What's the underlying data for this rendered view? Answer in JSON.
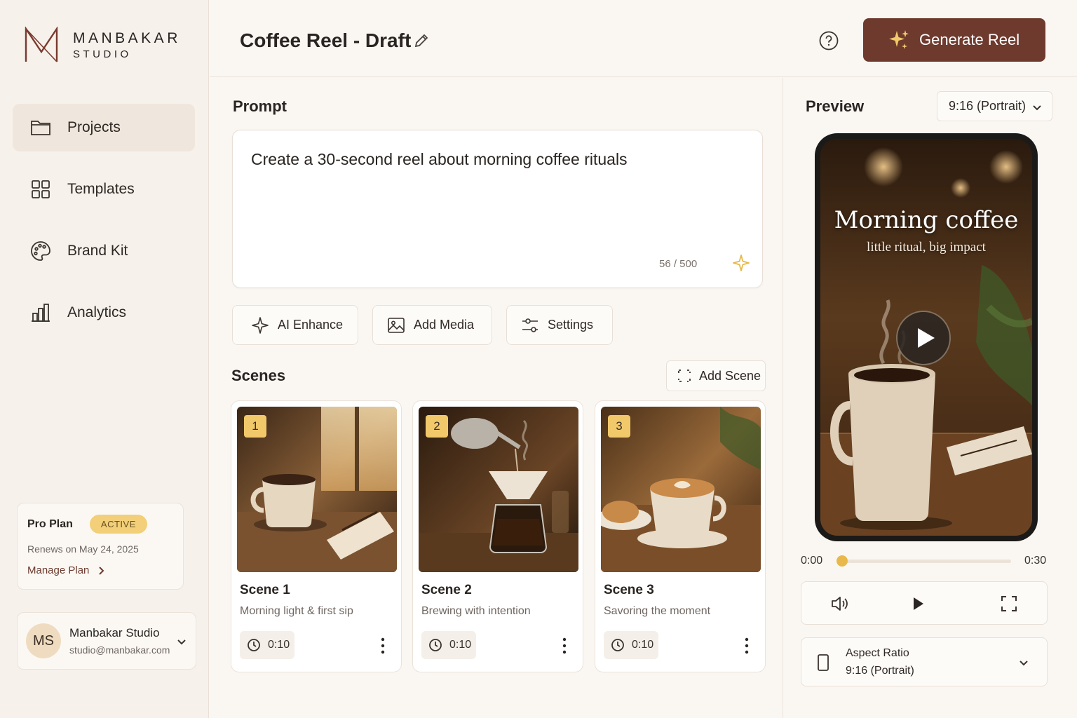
{
  "brand": {
    "name": "MANBAKAR",
    "sub": "STUDIO"
  },
  "sidebar": {
    "items": [
      {
        "label": "Projects",
        "icon": "folder-icon",
        "active": true
      },
      {
        "label": "Templates",
        "icon": "grid-icon"
      },
      {
        "label": "Brand Kit",
        "icon": "palette-icon"
      },
      {
        "label": "Analytics",
        "icon": "bar-chart-icon"
      }
    ]
  },
  "plan": {
    "title": "Pro Plan",
    "badge": "ACTIVE",
    "renews": "Renews on May 24, 2025",
    "manage": "Manage Plan"
  },
  "account": {
    "initials": "MS",
    "name": "Manbakar Studio",
    "email": "studio@manbakar.com"
  },
  "header": {
    "title": "Coffee Reel - Draft",
    "generate_label": "Generate Reel"
  },
  "prompt": {
    "section_title": "Prompt",
    "text": "Create a 30-second reel about morning coffee rituals",
    "char_count": "56 / 500"
  },
  "tools": {
    "ai_enhance": "AI Enhance",
    "add_media": "Add Media",
    "settings": "Settings"
  },
  "scenes": {
    "section_title": "Scenes",
    "add_label": "Add Scene",
    "items": [
      {
        "num": "1",
        "title": "Scene 1",
        "desc": "Morning light & first sip",
        "duration": "0:10"
      },
      {
        "num": "2",
        "title": "Scene 2",
        "desc": "Brewing with intention",
        "duration": "0:10"
      },
      {
        "num": "3",
        "title": "Scene 3",
        "desc": "Savoring the moment",
        "duration": "0:10"
      }
    ]
  },
  "preview": {
    "title": "Preview",
    "ratio": "9:16 (Portrait)",
    "overlay_title": "Morning coffee",
    "overlay_sub": "little ritual, big impact",
    "time_start": "0:00",
    "time_end": "0:30",
    "progress": 0,
    "aspect_label": "Aspect Ratio",
    "aspect_value": "9:16 (Portrait)"
  },
  "colors": {
    "accent": "#6e3a2e",
    "gold": "#f2c96a",
    "background": "#faf7f3"
  }
}
